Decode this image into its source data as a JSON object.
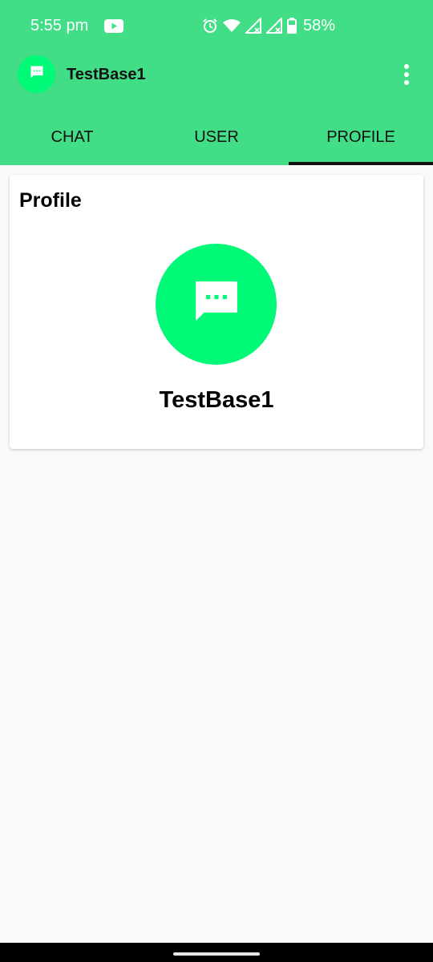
{
  "status_bar": {
    "time": "5:55 pm",
    "battery": "58%",
    "icons": [
      "youtube-icon",
      "alarm-icon",
      "wifi-icon",
      "signal-icon",
      "signal-icon",
      "battery-icon"
    ]
  },
  "app_bar": {
    "title": "TestBase1",
    "avatar_icon": "chat-bubble-icon",
    "menu_icon": "more-vert-icon"
  },
  "tabs": [
    {
      "label": "CHAT",
      "active": false
    },
    {
      "label": "USER",
      "active": false
    },
    {
      "label": "PROFILE",
      "active": true
    }
  ],
  "profile": {
    "heading": "Profile",
    "name": "TestBase1",
    "avatar_icon": "chat-bubble-icon"
  },
  "colors": {
    "header": "#41dd87",
    "accent": "#00f976",
    "background": "#f9f9f9",
    "card": "#ffffff",
    "tab_indicator": "#111111"
  }
}
